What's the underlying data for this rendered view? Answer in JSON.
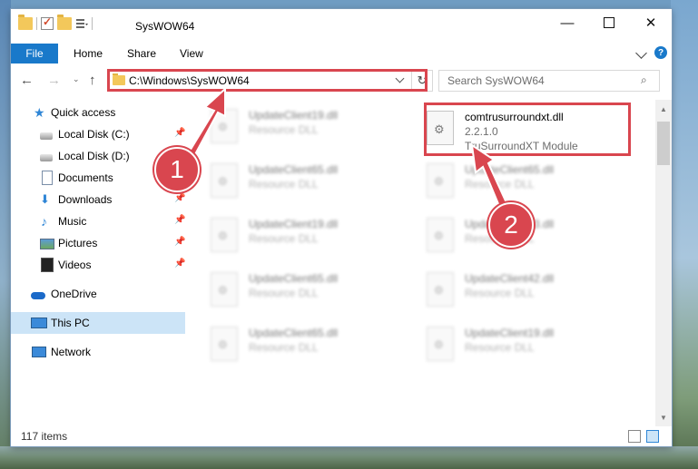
{
  "window": {
    "title": "SysWOW64",
    "buttons": {
      "minimize": "—",
      "close": "✕"
    }
  },
  "ribbon": {
    "tabs": [
      "File",
      "Home",
      "Share",
      "View"
    ],
    "help": "?"
  },
  "navigation": {
    "back": "←",
    "forward": "→",
    "up": "↑",
    "dropdown": "⌄",
    "address": "C:\\Windows\\SysWOW64",
    "refresh": "↻",
    "search_placeholder": "Search SysWOW64",
    "search_icon": "⌕"
  },
  "sidebar": {
    "items": [
      {
        "label": "Quick access",
        "icon": "star-icon",
        "pinned": false
      },
      {
        "label": "Local Disk (C:)",
        "icon": "drive-icon",
        "pinned": true
      },
      {
        "label": "Local Disk (D:)",
        "icon": "drive-icon",
        "pinned": false
      },
      {
        "label": "Documents",
        "icon": "documents-icon",
        "pinned": false
      },
      {
        "label": "Downloads",
        "icon": "download-icon",
        "pinned": true
      },
      {
        "label": "Music",
        "icon": "music-icon",
        "pinned": true
      },
      {
        "label": "Pictures",
        "icon": "pictures-icon",
        "pinned": true
      },
      {
        "label": "Videos",
        "icon": "videos-icon",
        "pinned": true
      },
      {
        "label": "OneDrive",
        "icon": "onedrive-icon",
        "pinned": false
      },
      {
        "label": "This PC",
        "icon": "computer-icon",
        "pinned": false,
        "selected": true
      },
      {
        "label": "Network",
        "icon": "network-icon",
        "pinned": false
      }
    ],
    "pin_glyph": "📌"
  },
  "files": {
    "left_column": [
      {
        "name": "UpdateClient19.dll",
        "type": "Resource DLL"
      },
      {
        "name": "UpdateClient65.dll",
        "type": "Resource DLL"
      },
      {
        "name": "UpdateClient19.dll",
        "type": "Resource DLL"
      },
      {
        "name": "UpdateClient65.dll",
        "type": "Resource DLL"
      },
      {
        "name": "UpdateClient65.dll",
        "type": "Resource DLL"
      }
    ],
    "right_column": [
      {
        "name": "UpdateClient65.dll",
        "type": "Resource DLL"
      },
      {
        "name": "UpdateClient63.dll",
        "type": "Resource DLL"
      },
      {
        "name": "UpdateClient42.dll",
        "type": "Resource DLL"
      },
      {
        "name": "UpdateClient19.dll",
        "type": "Resource DLL"
      }
    ],
    "highlighted": {
      "name": "comtrusurroundxt.dll",
      "version": "2.2.1.0",
      "description": "TruSurroundXT Module"
    }
  },
  "status": {
    "item_count": "117 items"
  },
  "annotations": {
    "callout_1": "1",
    "callout_2": "2",
    "accent_color": "#d9464f"
  }
}
